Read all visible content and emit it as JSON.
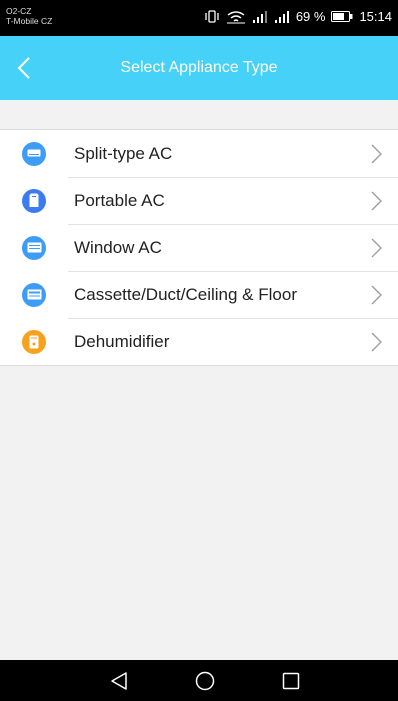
{
  "status_bar": {
    "carrier_line1": "O2-CZ",
    "carrier_line2": "T-Mobile CZ",
    "battery_percent": "69 %",
    "time": "15:14",
    "icons": [
      "vibrate-icon",
      "wifi-icon",
      "signal-icon",
      "signal-icon",
      "battery-icon"
    ]
  },
  "app_bar": {
    "title": "Select Appliance Type",
    "back_icon": "chevron-left-icon",
    "color": "#46d1f8"
  },
  "appliances": [
    {
      "label": "Split-type AC",
      "icon": "split-ac-icon",
      "color": "#3d9df6"
    },
    {
      "label": "Portable AC",
      "icon": "portable-ac-icon",
      "color": "#3d7cf0"
    },
    {
      "label": "Window AC",
      "icon": "window-ac-icon",
      "color": "#3d9df6"
    },
    {
      "label": "Cassette/Duct/Ceiling & Floor",
      "icon": "cassette-ac-icon",
      "color": "#3d9df6"
    },
    {
      "label": "Dehumidifier",
      "icon": "dehumidifier-icon",
      "color": "#f7a21c"
    }
  ],
  "nav_bar": {
    "icons": [
      "back-triangle-icon",
      "home-circle-icon",
      "recents-square-icon"
    ]
  }
}
